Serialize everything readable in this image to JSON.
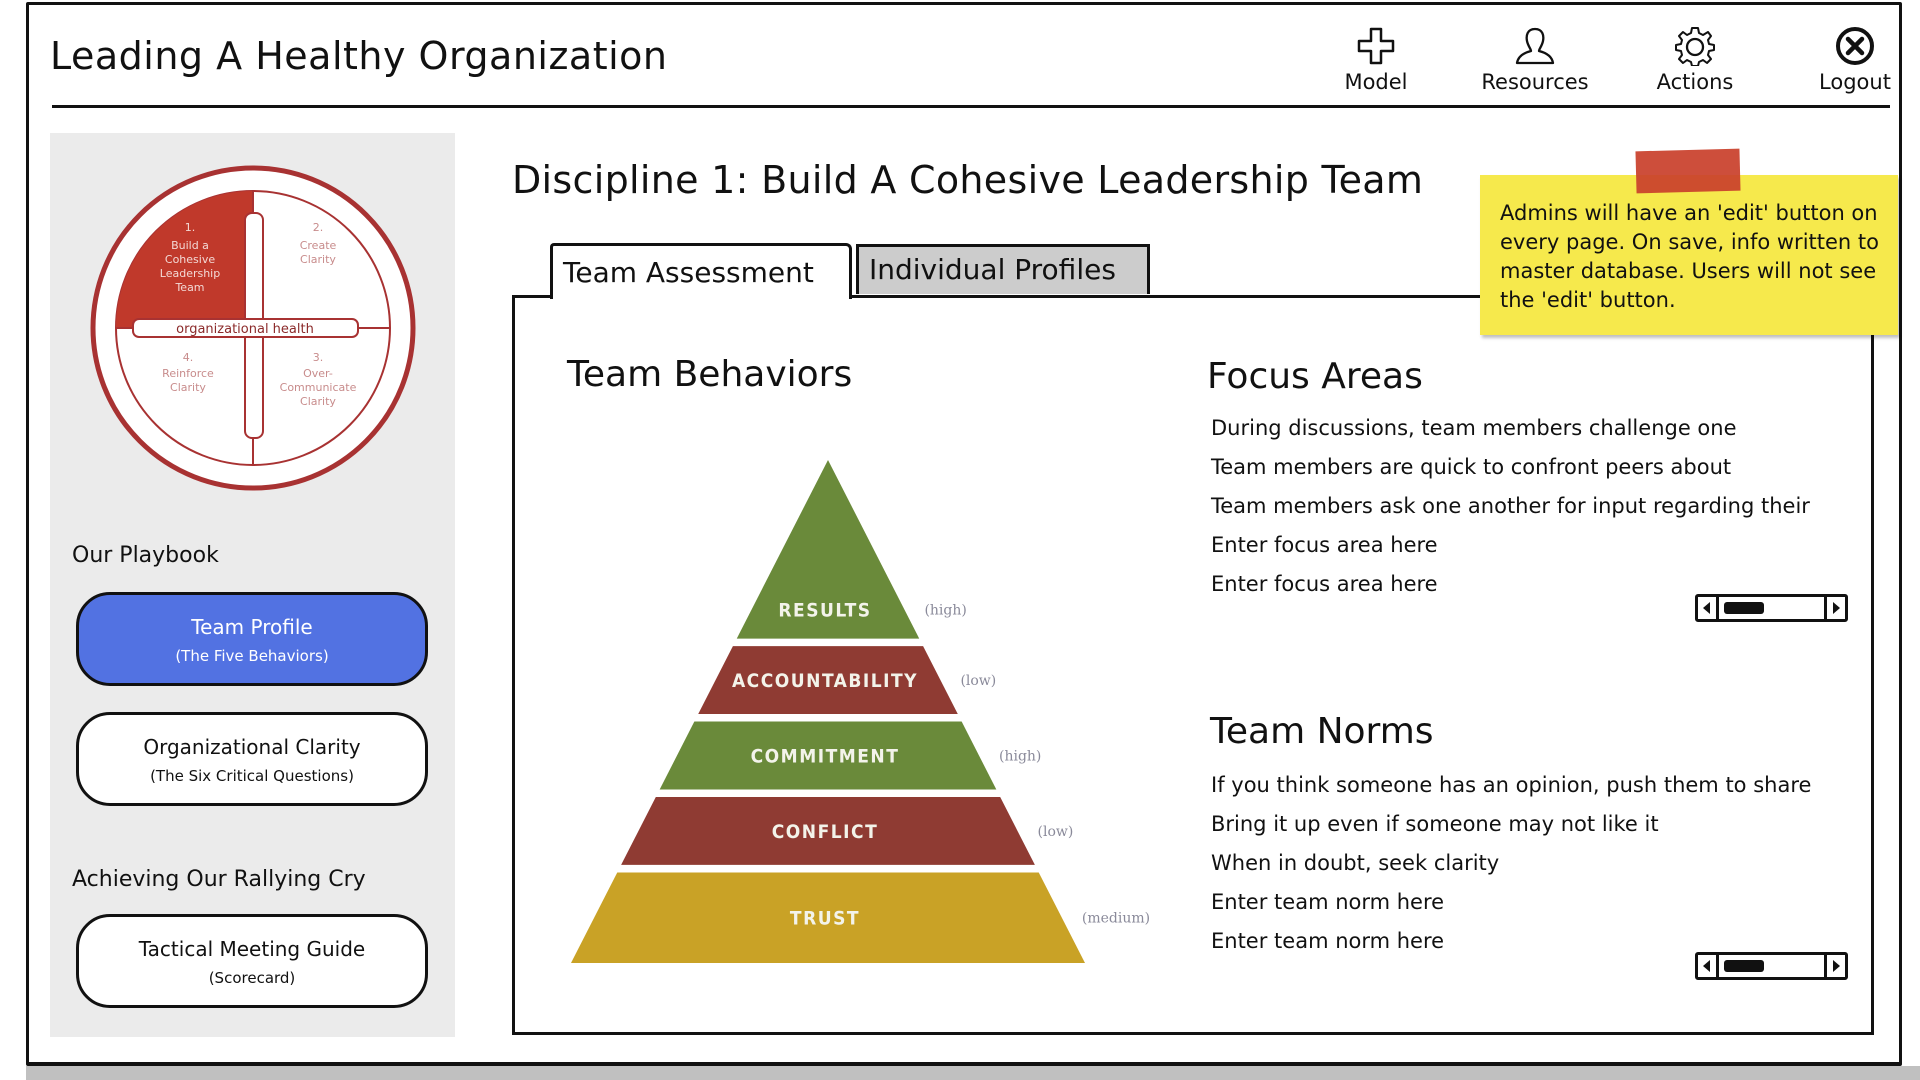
{
  "app": {
    "title": "Leading A Healthy Organization"
  },
  "nav": [
    {
      "label": "Model",
      "icon": "plus-icon"
    },
    {
      "label": "Resources",
      "icon": "user-icon"
    },
    {
      "label": "Actions",
      "icon": "gear-icon"
    },
    {
      "label": "Logout",
      "icon": "close-circle-icon"
    }
  ],
  "sidebar": {
    "logo": {
      "quadrants": [
        {
          "number": "1.",
          "lines": [
            "Build a",
            "Cohesive",
            "Leadership",
            "Team"
          ],
          "active": true
        },
        {
          "number": "2.",
          "lines": [
            "Create",
            "Clarity"
          ],
          "active": false
        },
        {
          "number": "3.",
          "lines": [
            "Over-",
            "Communicate",
            "Clarity"
          ],
          "active": false
        },
        {
          "number": "4.",
          "lines": [
            "Reinforce",
            "Clarity"
          ],
          "active": false
        }
      ],
      "center_label": "organizational health",
      "active_color": "#c0392b",
      "ring_color": "#a83232"
    },
    "sections": [
      {
        "heading": "Our Playbook",
        "buttons": [
          {
            "title": "Team Profile",
            "subtitle": "(The Five Behaviors)",
            "active": true
          },
          {
            "title": "Organizational Clarity",
            "subtitle": "(The Six Critical Questions)",
            "active": false
          }
        ]
      },
      {
        "heading": "Achieving Our Rallying Cry",
        "buttons": [
          {
            "title": "Tactical Meeting Guide",
            "subtitle": "(Scorecard)",
            "active": false
          }
        ]
      }
    ],
    "active_color": "#5272e2"
  },
  "main": {
    "heading": "Discipline 1: Build A Cohesive Leadership Team",
    "tabs": [
      {
        "label": "Team Assessment",
        "active": true
      },
      {
        "label": "Individual Profiles",
        "active": false
      }
    ],
    "sticky_note": {
      "text": "Admins will have an 'edit' button on every page.  On save, info written to master database. Users will not see the 'edit' button.",
      "color": "#f6e94c",
      "tape_color": "#c9412c"
    },
    "team_behaviors": {
      "heading": "Team Behaviors",
      "pyramid": [
        {
          "label": "RESULTS",
          "level": "(high)",
          "color": "#6a8a3a"
        },
        {
          "label": "ACCOUNTABILITY",
          "level": "(low)",
          "color": "#8f3b33"
        },
        {
          "label": "COMMITMENT",
          "level": "(high)",
          "color": "#6a8a3a"
        },
        {
          "label": "CONFLICT",
          "level": "(low)",
          "color": "#8f3b33"
        },
        {
          "label": "TRUST",
          "level": "(medium)",
          "color": "#c9a226"
        }
      ]
    },
    "focus_areas": {
      "heading": "Focus Areas",
      "items": [
        "During discussions, team members challenge one",
        "Team members are quick to confront peers about",
        "Team members ask one another for input regarding their",
        "Enter focus area here",
        "Enter focus area here"
      ]
    },
    "team_norms": {
      "heading": "Team Norms",
      "items": [
        "If you think someone has an opinion, push them to share",
        "Bring it up even if someone may not like it",
        "When in doubt, seek clarity",
        "Enter team norm here",
        "Enter team norm here"
      ]
    }
  }
}
